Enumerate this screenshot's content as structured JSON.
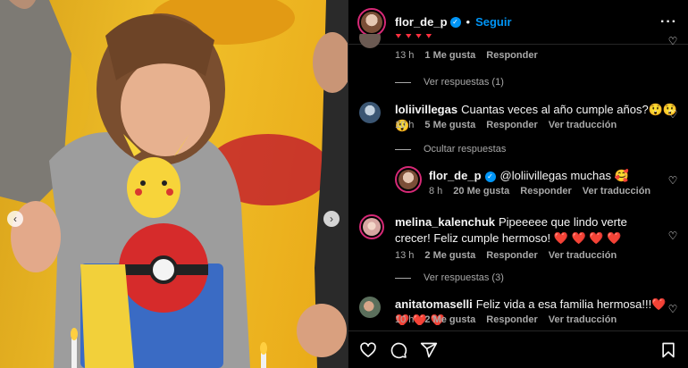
{
  "header": {
    "username": "flor_de_p",
    "separator": "•",
    "follow_label": "Seguir",
    "more_label": "···"
  },
  "carousel": {
    "prev_label": "‹",
    "next_label": "›"
  },
  "comments": [
    {
      "id": "c0",
      "text": "",
      "time": "13 h",
      "likes": "1 Me gusta",
      "reply": "Responder",
      "translate": ""
    },
    {
      "id": "c1",
      "user": "loliivillegas",
      "text": "Cuantas veces al año cumple años?",
      "emojis": "😲😲😲",
      "time": "10 h",
      "likes": "5 Me gusta",
      "reply": "Responder",
      "translate": "Ver traducción"
    },
    {
      "id": "c2",
      "user": "flor_de_p",
      "text": "@loliivillegas muchas",
      "emojis": "🥰",
      "time": "8 h",
      "likes": "20 Me gusta",
      "reply": "Responder",
      "translate": "Ver traducción"
    },
    {
      "id": "c3",
      "user": "melina_kalenchuk",
      "text": "Pipeeeee que lindo verte crecer! Feliz cumple hermoso!",
      "emojis": "❤️ ❤️ ❤️ ❤️",
      "time": "13 h",
      "likes": "2 Me gusta",
      "reply": "Responder",
      "translate": "Ver traducción"
    },
    {
      "id": "c4",
      "user": "anitatomaselli",
      "text": "Feliz vida a esa familia hermosa!!!",
      "emojis": "❤️ ❤️ ❤️ ❤️",
      "time": "10 h",
      "likes": "2 Me gusta",
      "reply": "Responder",
      "translate": "Ver traducción"
    }
  ],
  "reply_toggles": {
    "c0": "Ver respuestas (1)",
    "c1": "Ocultar respuestas",
    "c3": "Ver respuestas (3)"
  },
  "icons": {
    "heart": "heart-icon",
    "comment": "comment-icon",
    "share": "share-icon",
    "save": "bookmark-icon"
  },
  "colors": {
    "accent": "#0095f6",
    "muted": "#a8a8a8",
    "background": "#000000"
  }
}
